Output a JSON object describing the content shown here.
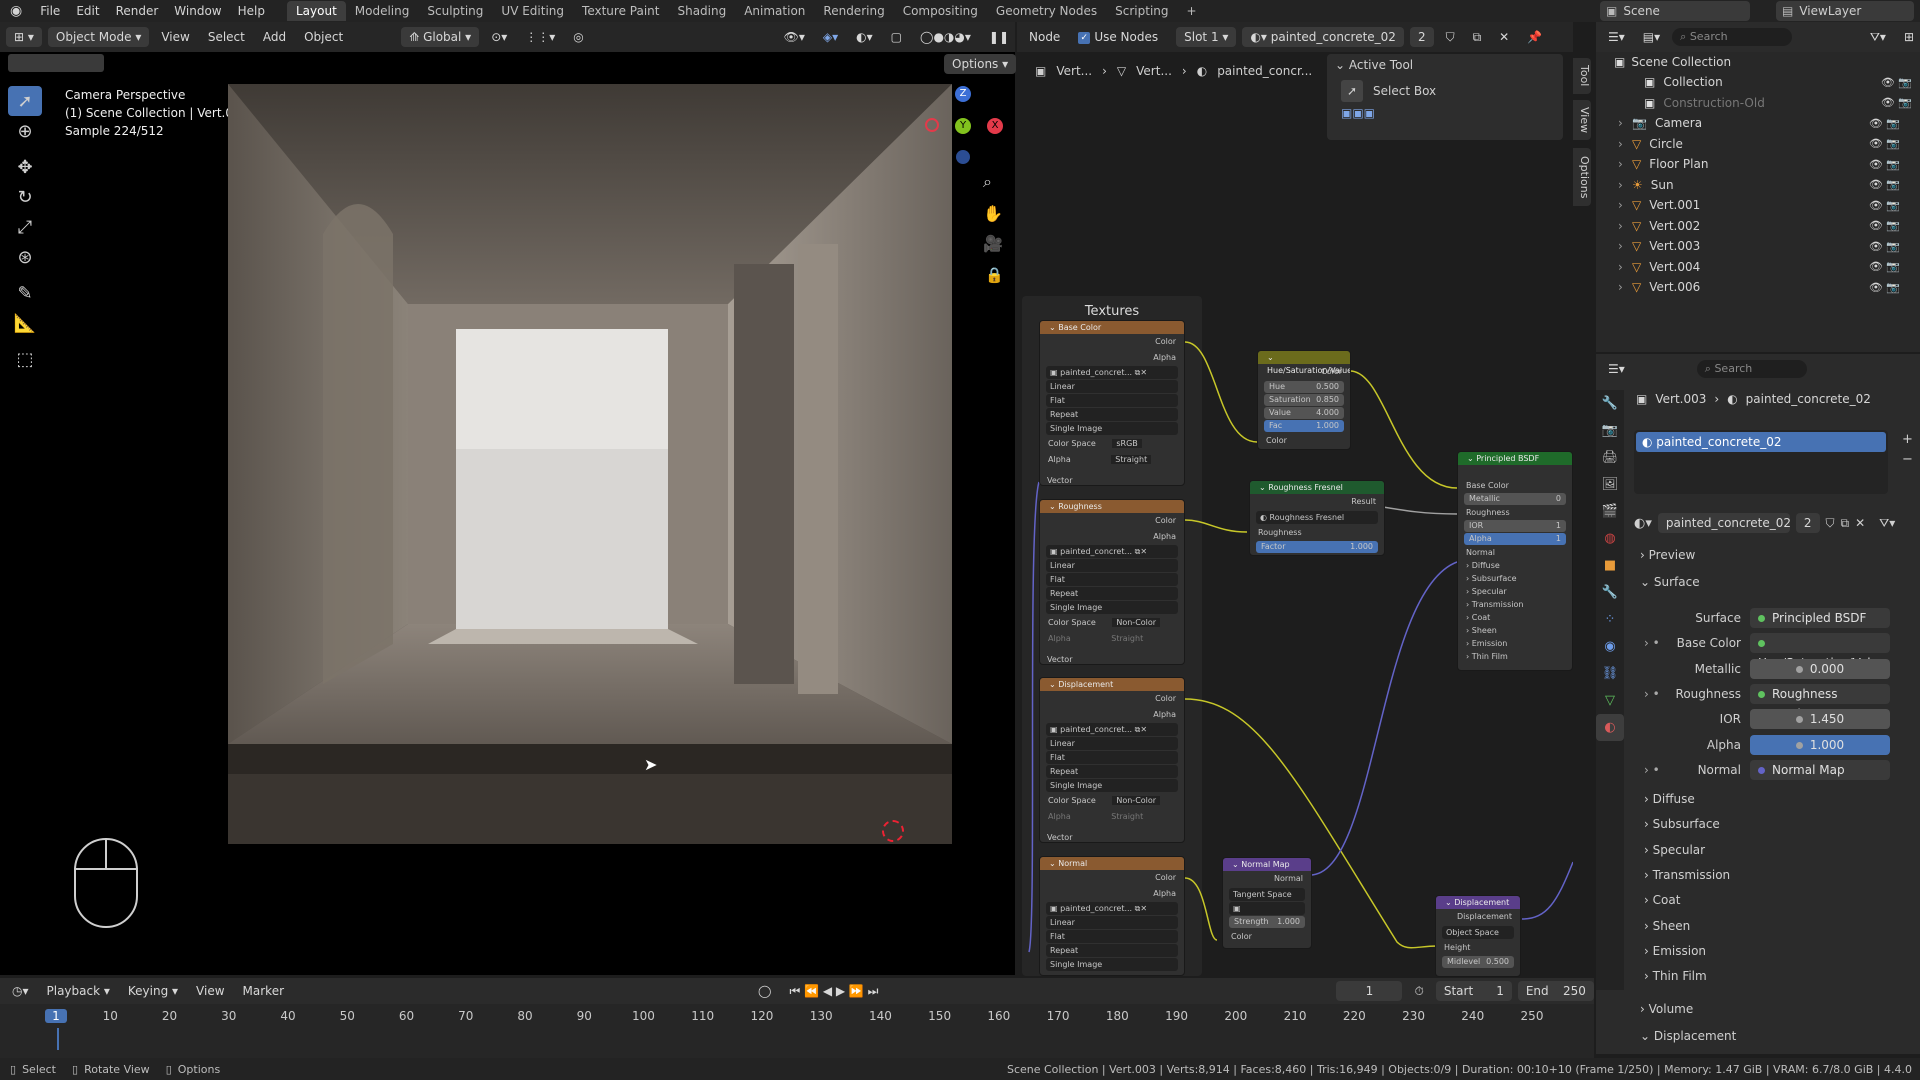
{
  "menu": {
    "items": [
      "File",
      "Edit",
      "Render",
      "Window",
      "Help"
    ]
  },
  "workspaces": [
    "Layout",
    "Modeling",
    "Sculpting",
    "UV Editing",
    "Texture Paint",
    "Shading",
    "Animation",
    "Rendering",
    "Compositing",
    "Geometry Nodes",
    "Scripting"
  ],
  "top_right": {
    "scene": "Scene",
    "view_layer": "ViewLayer"
  },
  "viewport": {
    "mode": "Object Mode",
    "menus": [
      "View",
      "Select",
      "Add",
      "Object"
    ],
    "transform": "Global",
    "options": "Options",
    "info_line1": "Camera Perspective",
    "info_line2": "(1) Scene Collection | Vert.003",
    "info_line3": "Sample 224/512",
    "gizmo_z": "Z",
    "gizmo_y": "Y",
    "gizmo_x": "X"
  },
  "node_editor": {
    "menu_node": "Node",
    "use_nodes": "Use Nodes",
    "slot": "Slot 1",
    "material": "painted_concrete_02",
    "users": "2",
    "breadcrumb": [
      "Vert...",
      "Vert...",
      "painted_concr..."
    ],
    "active_tool": "Active Tool",
    "select_box": "Select Box",
    "frame_label": "Textures",
    "side_tabs": [
      "Tool",
      "View",
      "Options"
    ]
  },
  "nodes": {
    "base_color": {
      "title": "Base Color",
      "out": [
        "Color",
        "Alpha"
      ],
      "image": "painted_concret...",
      "interp": "Linear",
      "proj": "Flat",
      "ext": "Repeat",
      "src": "Single Image",
      "cs_label": "Color Space",
      "cs": "sRGB",
      "alpha_label": "Alpha",
      "alpha": "Straight",
      "vec": "Vector"
    },
    "roughness": {
      "title": "Roughness",
      "out": [
        "Color",
        "Alpha"
      ],
      "image": "painted_concret...",
      "interp": "Linear",
      "proj": "Flat",
      "ext": "Repeat",
      "src": "Single Image",
      "cs_label": "Color Space",
      "cs": "Non-Color",
      "alpha_label": "Alpha",
      "alpha": "Straight",
      "vec": "Vector"
    },
    "displacement_tex": {
      "title": "Displacement",
      "out": [
        "Color",
        "Alpha"
      ],
      "image": "painted_concret...",
      "interp": "Linear",
      "proj": "Flat",
      "ext": "Repeat",
      "src": "Single Image",
      "cs_label": "Color Space",
      "cs": "Non-Color",
      "alpha_label": "Alpha",
      "alpha": "Straight",
      "vec": "Vector"
    },
    "normal_tex": {
      "title": "Normal",
      "out": [
        "Color",
        "Alpha"
      ],
      "image": "painted_concret...",
      "interp": "Linear",
      "proj": "Flat",
      "ext": "Repeat",
      "src": "Single Image"
    },
    "hsv": {
      "title": "Hue/Saturation/Value",
      "out": "Color",
      "rows": [
        [
          "Hue",
          "0.500"
        ],
        [
          "Saturation",
          "0.850"
        ],
        [
          "Value",
          "4.000"
        ],
        [
          "Fac",
          "1.000"
        ]
      ],
      "in": "Color"
    },
    "fresnel": {
      "title": "Roughness Fresnel",
      "out": "Result",
      "sub": "Roughness Fresnel",
      "in1": "Roughness",
      "in2": "Factor",
      "in2_val": "1.000"
    },
    "bsdf": {
      "title": "Principled BSDF",
      "rows": [
        "Base Color",
        "Metallic",
        "Roughness",
        "IOR",
        "Alpha",
        "Normal"
      ],
      "metallic": "0",
      "ior": "1",
      "alpha": "1",
      "panels": [
        "Diffuse",
        "Subsurface",
        "Specular",
        "Transmission",
        "Coat",
        "Sheen",
        "Emission",
        "Thin Film"
      ]
    },
    "normal_map": {
      "title": "Normal Map",
      "out": "Normal",
      "space": "Tangent Space",
      "strength_label": "Strength",
      "strength": "1.000",
      "in": "Color"
    },
    "displacement": {
      "title": "Displacement",
      "out": "Displacement",
      "space": "Object Space",
      "in1": "Height",
      "mid_label": "Midlevel",
      "mid": "0.500"
    }
  },
  "outliner": {
    "root": "Scene Collection",
    "search": "Search",
    "items": [
      {
        "name": "Collection",
        "type": "collection"
      },
      {
        "name": "Construction-Old",
        "type": "collection"
      },
      {
        "name": "Camera",
        "type": "camera"
      },
      {
        "name": "Circle",
        "type": "mesh"
      },
      {
        "name": "Floor Plan",
        "type": "mesh"
      },
      {
        "name": "Sun",
        "type": "light"
      },
      {
        "name": "Vert.001",
        "type": "mesh"
      },
      {
        "name": "Vert.002",
        "type": "mesh"
      },
      {
        "name": "Vert.003",
        "type": "mesh"
      },
      {
        "name": "Vert.004",
        "type": "mesh"
      },
      {
        "name": "Vert.006",
        "type": "mesh"
      }
    ]
  },
  "properties": {
    "search": "Search",
    "breadcrumb_obj": "Vert.003",
    "breadcrumb_mat": "painted_concrete_02",
    "slot_material": "painted_concrete_02",
    "material_name": "painted_concrete_02",
    "users": "2",
    "preview": "Preview",
    "surface": "Surface",
    "rows": [
      {
        "label": "Surface",
        "value": "Principled BSDF",
        "kind": "link"
      },
      {
        "label": "Base Color",
        "value": "Hue/Saturation/Value",
        "kind": "link"
      },
      {
        "label": "Metallic",
        "value": "0.000",
        "kind": "num"
      },
      {
        "label": "Roughness",
        "value": "Roughness Fresnel",
        "kind": "link"
      },
      {
        "label": "IOR",
        "value": "1.450",
        "kind": "num"
      },
      {
        "label": "Alpha",
        "value": "1.000",
        "kind": "numblue"
      },
      {
        "label": "Normal",
        "value": "Normal Map",
        "kind": "link"
      }
    ],
    "panels": [
      "Diffuse",
      "Subsurface",
      "Specular",
      "Transmission",
      "Coat",
      "Sheen",
      "Emission",
      "Thin Film"
    ],
    "volume": "Volume",
    "displacement": "Displacement"
  },
  "timeline": {
    "menus": [
      "Playback",
      "Keying",
      "View",
      "Marker"
    ],
    "current": "1",
    "start_label": "Start",
    "start": "1",
    "end_label": "End",
    "end": "250",
    "ticks": [
      "1",
      "10",
      "20",
      "30",
      "40",
      "50",
      "60",
      "70",
      "80",
      "90",
      "100",
      "110",
      "120",
      "130",
      "140",
      "150",
      "160",
      "170",
      "180",
      "190",
      "200",
      "210",
      "220",
      "230",
      "240",
      "250"
    ]
  },
  "statusbar": {
    "select": "Select",
    "rotate": "Rotate View",
    "options": "Options",
    "stats": "Scene Collection | Vert.003 | Verts:8,914 | Faces:8,460 | Tris:16,949 | Objects:0/9 | Duration: 00:10+10 (Frame 1/250) | Memory: 1.47 GiB | VRAM: 6.7/8.0 GiB | 4.4.0"
  },
  "colors": {
    "accent": "#4772b3",
    "texture_header": "#8a5a30",
    "vector_header": "#5a3e8a",
    "shader_header": "#1f6b2a",
    "color_header": "#6b6b1c"
  }
}
